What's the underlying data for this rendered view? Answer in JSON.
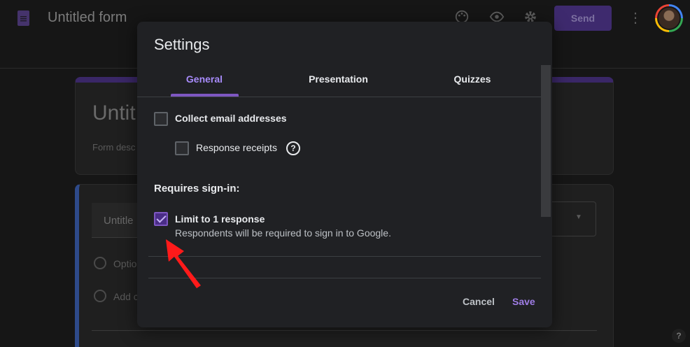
{
  "header": {
    "app_title": "Untitled form",
    "send_label": "Send",
    "icons": [
      "form-icon",
      "palette-icon",
      "preview-icon",
      "settings-icon",
      "more-icon",
      "avatar"
    ]
  },
  "background_form": {
    "title": "Untit",
    "description": "Form desc",
    "question_title": "Untitle",
    "options": [
      "Optio",
      "Add c"
    ]
  },
  "settings_dialog": {
    "title": "Settings",
    "tabs": [
      {
        "label": "General",
        "active": true
      },
      {
        "label": "Presentation",
        "active": false
      },
      {
        "label": "Quizzes",
        "active": false
      }
    ],
    "collect_email": {
      "label": "Collect email addresses",
      "checked": false
    },
    "response_receipts": {
      "label": "Response receipts",
      "checked": false,
      "help": "?"
    },
    "requires_signin_heading": "Requires sign-in:",
    "limit_response": {
      "label": "Limit to 1 response",
      "description": "Respondents will be required to sign in to Google.",
      "checked": true
    },
    "cancel_label": "Cancel",
    "save_label": "Save"
  },
  "colors": {
    "accent": "#7e57c2",
    "annotation_arrow": "#ff1a1a",
    "dialog_bg": "#202124"
  }
}
